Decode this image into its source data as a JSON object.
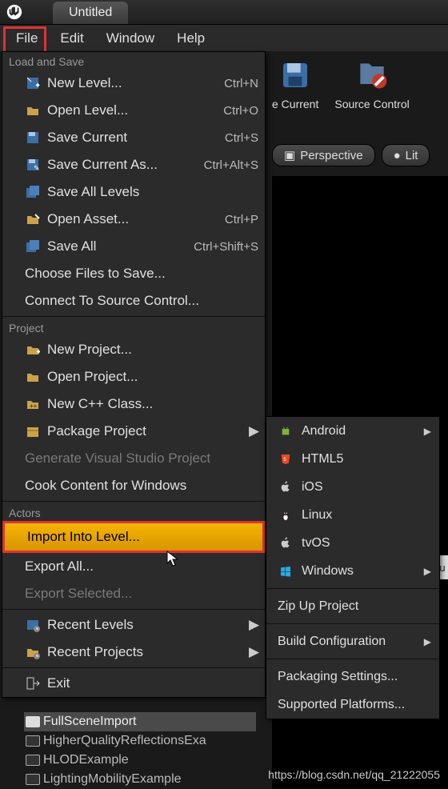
{
  "title": "Untitled",
  "menubar": {
    "file": "File",
    "edit": "Edit",
    "window": "Window",
    "help": "Help"
  },
  "sections": {
    "load_save": "Load and Save",
    "project": "Project",
    "actors": "Actors"
  },
  "file_menu": {
    "new_level": "New Level...",
    "new_level_sc": "Ctrl+N",
    "open_level": "Open Level...",
    "open_level_sc": "Ctrl+O",
    "save_current": "Save Current",
    "save_current_sc": "Ctrl+S",
    "save_current_as": "Save Current As...",
    "save_current_as_sc": "Ctrl+Alt+S",
    "save_all_levels": "Save All Levels",
    "open_asset": "Open Asset...",
    "open_asset_sc": "Ctrl+P",
    "save_all": "Save All",
    "save_all_sc": "Ctrl+Shift+S",
    "choose_files": "Choose Files to Save...",
    "connect_source": "Connect To Source Control...",
    "new_project": "New Project...",
    "open_project": "Open Project...",
    "new_cpp": "New C++ Class...",
    "package_project": "Package Project",
    "generate_vs": "Generate Visual Studio Project",
    "cook_content": "Cook Content for Windows",
    "import_into_level": "Import Into Level...",
    "export_all": "Export All...",
    "export_selected": "Export Selected...",
    "recent_levels": "Recent Levels",
    "recent_projects": "Recent Projects",
    "exit": "Exit"
  },
  "submenu": {
    "android": "Android",
    "html5": "HTML5",
    "ios": "iOS",
    "linux": "Linux",
    "tvos": "tvOS",
    "windows": "Windows",
    "zip": "Zip Up Project",
    "build_config": "Build Configuration",
    "packaging_settings": "Packaging Settings...",
    "supported_platforms": "Supported Platforms..."
  },
  "bg": {
    "save_current": "e Current",
    "source_control": "Source Control",
    "perspective": "Perspective",
    "lit": "Lit",
    "fu": "Fu"
  },
  "content_browser": {
    "r1": "FullSceneImport",
    "r2": "HigherQualityReflectionsExa",
    "r3": "HLODExample",
    "r4": "LightingMobilityExample"
  },
  "watermark": "https://blog.csdn.net/qq_21222055"
}
